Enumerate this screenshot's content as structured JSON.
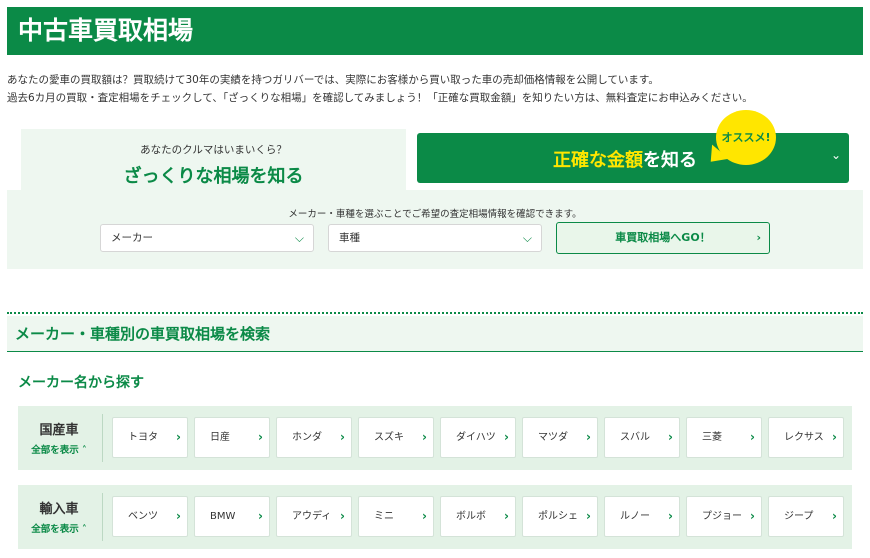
{
  "title": "中古車買取相場",
  "intro": {
    "line1": "あなたの愛車の買取額は？買取続けて30年の実績を持つガリバーでは、実際にお客様から買い取った車の売却価格情報を公開しています。",
    "line2": "過去6カ月の買取・査定相場をチェックして、「ざっくりな相場」を確認してみましょう！「正確な買取金額」を知りたい方は、無料査定にお申込みください。"
  },
  "tabs": {
    "left_sub": "あなたのクルマはいまいくら？",
    "left_main": "ざっくりな相場を知る",
    "right_main_highlight": "正確な金額",
    "right_main_rest": "を知る",
    "right_chevron": "⌄",
    "badge": "オススメ!"
  },
  "search": {
    "note": "メーカー・車種を選ぶことでご希望の査定相場情報を確認できます。",
    "maker_select": "メーカー",
    "model_select": "車種",
    "go_button": "車買取相場へGO！"
  },
  "section": {
    "heading": "メーカー・車種別の車買取相場を検索",
    "subheading": "メーカー名から探す"
  },
  "groups": [
    {
      "name": "国産車",
      "all_label": "全部を表示 ˄",
      "makers": [
        "トヨタ",
        "日産",
        "ホンダ",
        "スズキ",
        "ダイハツ",
        "マツダ",
        "スバル",
        "三菱",
        "レクサス"
      ]
    },
    {
      "name": "輸入車",
      "all_label": "全部を表示 ˄",
      "makers": [
        "ベンツ",
        "BMW",
        "アウディ",
        "ミニ",
        "ボルボ",
        "ポルシェ",
        "ルノー",
        "プジョー",
        "ジープ"
      ]
    }
  ],
  "colors": {
    "brand_green": "#0b8a47",
    "light_green": "#eef7f0",
    "accent_yellow": "#ffe600"
  },
  "icons": {
    "chevron_right": "chevron-right-icon",
    "chevron_down": "chevron-down-icon"
  }
}
